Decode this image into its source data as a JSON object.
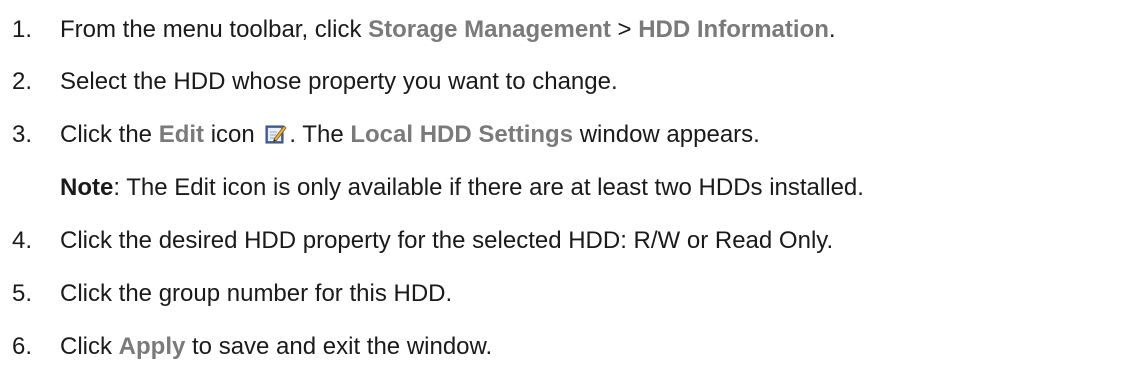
{
  "steps": [
    {
      "number": "1.",
      "parts": [
        "From the menu toolbar, click ",
        "Storage Management",
        " > ",
        "HDD Information",
        "."
      ]
    },
    {
      "number": "2.",
      "parts": [
        "Select the HDD whose property you want to change."
      ]
    },
    {
      "number": "3.",
      "parts": [
        "Click the ",
        "Edit",
        " icon ",
        ". The ",
        "Local HDD Settings",
        " window appears."
      ],
      "icon": "edit-icon"
    },
    {
      "note": {
        "label": "Note",
        "text": ": The Edit icon is only available if there are at least two HDDs installed."
      }
    },
    {
      "number": "4.",
      "parts": [
        "Click the desired HDD property for the selected HDD: R/W or Read Only."
      ]
    },
    {
      "number": "5.",
      "parts": [
        "Click the group number for this HDD."
      ]
    },
    {
      "number": "6.",
      "parts": [
        "Click ",
        "Apply",
        " to save and exit the window."
      ]
    }
  ],
  "colors": {
    "text": "#1a1a1a",
    "ui_term": "#7a7a7a"
  }
}
